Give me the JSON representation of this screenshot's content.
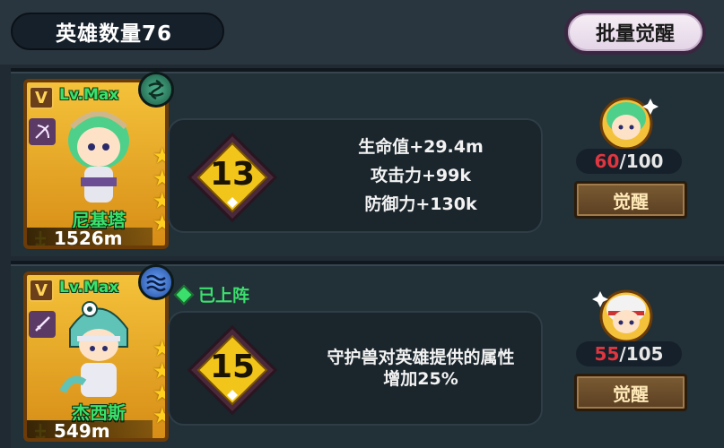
{
  "header": {
    "hero_count_label": "英雄数量76",
    "batch_awaken_label": "批量觉醒"
  },
  "heroes": [
    {
      "badge": "V",
      "level": "Lv.Max",
      "class_icon": "bow-icon",
      "element_icon": "wind-icon",
      "stars": 4,
      "name": "尼基塔",
      "power": "1526m",
      "deployed": false,
      "awaken_level": "13",
      "stats": [
        "生命值+29.4m",
        "攻击力+99k",
        "防御力+130k"
      ],
      "shard_current": "60",
      "shard_separator": "/",
      "shard_max": "100",
      "awaken_button": "觉醒",
      "colors": {
        "frame": "#f4c23a",
        "element": "#4fb48e"
      }
    },
    {
      "badge": "V",
      "level": "Lv.Max",
      "class_icon": "sword-icon",
      "element_icon": "water-icon",
      "stars": 4,
      "name": "杰西斯",
      "power": "549m",
      "deployed": true,
      "deployed_label": "已上阵",
      "awaken_level": "15",
      "stats": [
        "守护兽对英雄提供的属性",
        "增加25%"
      ],
      "shard_current": "55",
      "shard_separator": "/",
      "shard_max": "105",
      "awaken_button": "觉醒",
      "colors": {
        "frame": "#f4c23a",
        "element": "#6ca6ff"
      }
    }
  ]
}
